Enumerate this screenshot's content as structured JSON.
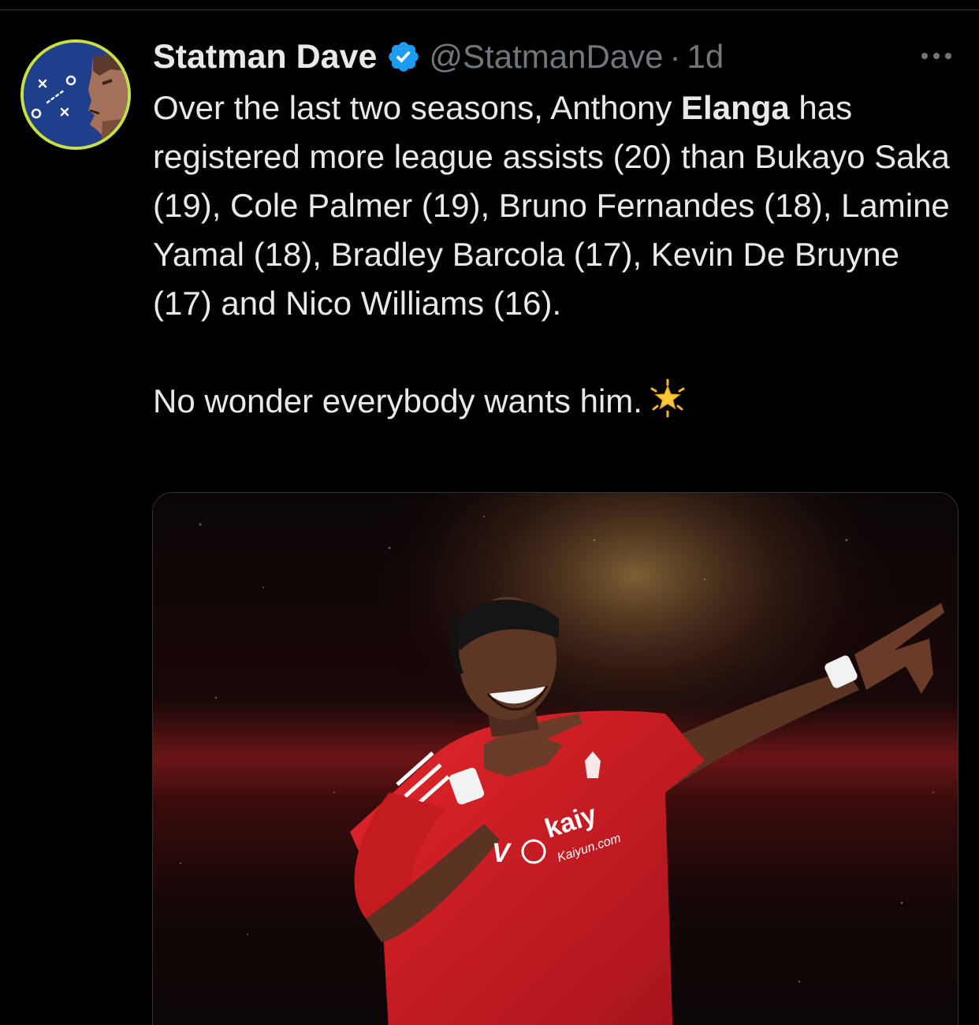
{
  "colors": {
    "background": "#000000",
    "text_primary": "#e7e9ea",
    "text_secondary": "#71767b",
    "verified_blue": "#1d9bf0",
    "avatar_ring": "#c6e046",
    "jersey_red": "#d41a1f"
  },
  "tweet": {
    "author": {
      "display_name": "Statman Dave",
      "handle": "@StatmanDave",
      "verified": true,
      "avatar_icon": "tactics-board-avatar"
    },
    "separator": "·",
    "timestamp": "1d",
    "more_icon": "more-horizontal-icon",
    "text": {
      "l1_a": "Over the last two seasons, Anthony ",
      "l1_bold": "Elanga",
      "l1_b": " has registered more league assists (20) than Bukayo Saka (19), Cole Palmer (19), Bruno Fernandes (18), Lamine Yamal (18), Bradley Barcola (17), Kevin De Bruyne (17) and Nico Williams (16).",
      "l2": "No wonder everybody wants him.",
      "emoji": "glowing-star-icon"
    },
    "media": {
      "kind": "photo",
      "subject": "footballer-celebrating-photo",
      "sponsor_text_main": "kaiy",
      "sponsor_text_url": "Kaiyun.com"
    }
  }
}
